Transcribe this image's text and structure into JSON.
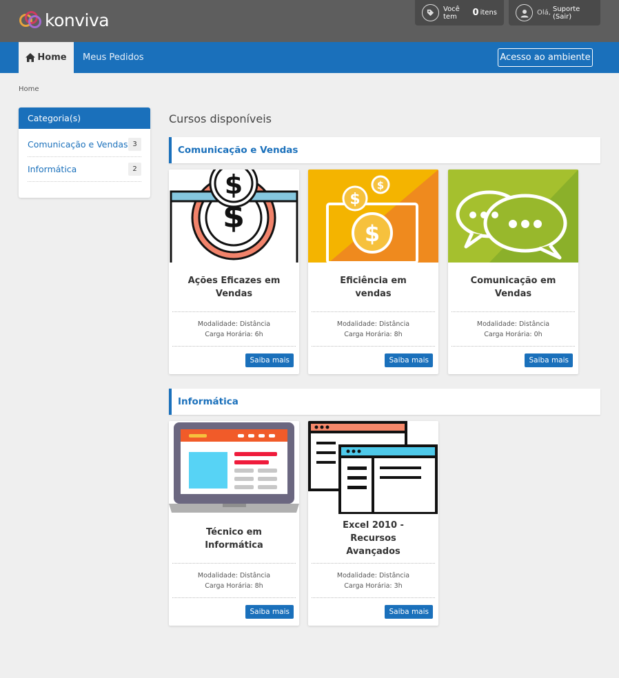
{
  "brand": {
    "name": "konviva"
  },
  "header": {
    "cart_prefix": "Você tem",
    "cart_count": "0",
    "cart_suffix": "itens",
    "user_greeting": "Olá,",
    "user_name": "Suporte (Sair)"
  },
  "nav": {
    "home": "Home",
    "orders": "Meus Pedidos",
    "access": "Acesso ao ambiente"
  },
  "breadcrumb": "Home",
  "sidebar": {
    "title": "Categoria(s)",
    "items": [
      {
        "label": "Comunicação e Vendas",
        "count": "3"
      },
      {
        "label": "Informática",
        "count": "2"
      }
    ]
  },
  "main": {
    "title": "Cursos disponíveis",
    "sections": [
      {
        "title": "Comunicação e Vendas",
        "courses": [
          {
            "title": "Ações Eficazes em Vendas",
            "modality": "Modalidade: Distância",
            "hours": "Carga Horária: 6h",
            "button": "Saiba mais",
            "icon": "coin-slot-icon"
          },
          {
            "title": "Eficiência em vendas",
            "modality": "Modalidade: Distância",
            "hours": "Carga Horária: 8h",
            "button": "Saiba mais",
            "icon": "coins-screen-icon"
          },
          {
            "title": "Comunicação em Vendas",
            "modality": "Modalidade: Distância",
            "hours": "Carga Horária: 0h",
            "button": "Saiba mais",
            "icon": "chat-bubbles-icon"
          }
        ]
      },
      {
        "title": "Informática",
        "courses": [
          {
            "title": "Técnico em Informática",
            "modality": "Modalidade: Distância",
            "hours": "Carga Horária: 8h",
            "button": "Saiba mais",
            "icon": "laptop-icon"
          },
          {
            "title": "Excel 2010 - Recursos Avançados",
            "modality": "Modalidade: Distância",
            "hours": "Carga Horária: 3h",
            "button": "Saiba mais",
            "icon": "windows-icon"
          }
        ]
      }
    ]
  },
  "colors": {
    "primary": "#1a70bb",
    "header": "#5e5e5e",
    "background": "#efefef"
  }
}
